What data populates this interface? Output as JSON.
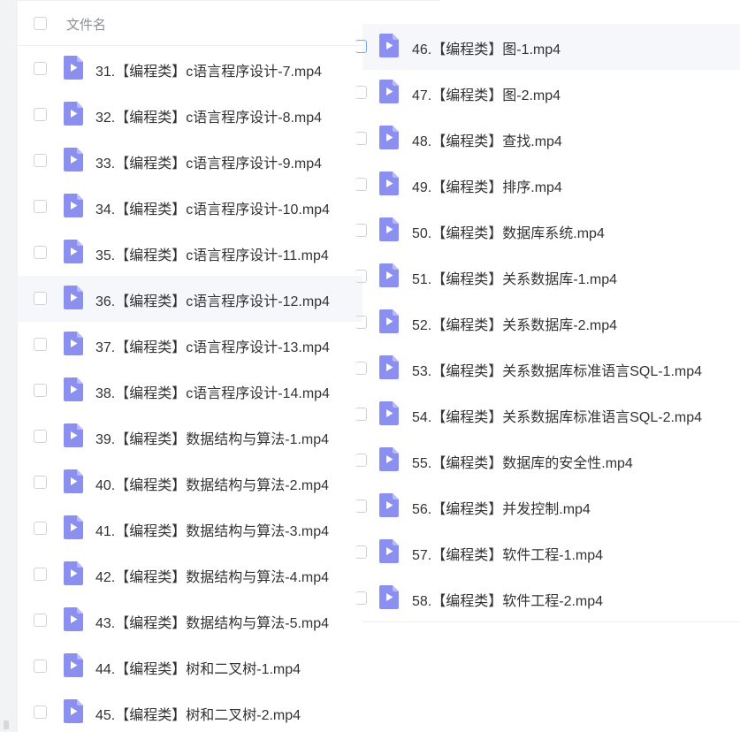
{
  "header": {
    "column_label": "文件名"
  },
  "icons": {
    "file": "video-file-icon",
    "color": "#8b8ff0"
  },
  "left_list": [
    {
      "name": "31.【编程类】c语言程序设计-7.mp4"
    },
    {
      "name": "32.【编程类】c语言程序设计-8.mp4"
    },
    {
      "name": "33.【编程类】c语言程序设计-9.mp4"
    },
    {
      "name": "34.【编程类】c语言程序设计-10.mp4"
    },
    {
      "name": "35.【编程类】c语言程序设计-11.mp4"
    },
    {
      "name": "36.【编程类】c语言程序设计-12.mp4"
    },
    {
      "name": "37.【编程类】c语言程序设计-13.mp4"
    },
    {
      "name": "38.【编程类】c语言程序设计-14.mp4"
    },
    {
      "name": "39.【编程类】数据结构与算法-1.mp4"
    },
    {
      "name": "40.【编程类】数据结构与算法-2.mp4"
    },
    {
      "name": "41.【编程类】数据结构与算法-3.mp4"
    },
    {
      "name": "42.【编程类】数据结构与算法-4.mp4"
    },
    {
      "name": "43.【编程类】数据结构与算法-5.mp4"
    },
    {
      "name": "44.【编程类】树和二叉树-1.mp4"
    },
    {
      "name": "45.【编程类】树和二叉树-2.mp4"
    }
  ],
  "right_list": [
    {
      "name": "46.【编程类】图-1.mp4"
    },
    {
      "name": "47.【编程类】图-2.mp4"
    },
    {
      "name": "48.【编程类】查找.mp4"
    },
    {
      "name": "49.【编程类】排序.mp4"
    },
    {
      "name": "50.【编程类】数据库系统.mp4"
    },
    {
      "name": "51.【编程类】关系数据库-1.mp4"
    },
    {
      "name": "52.【编程类】关系数据库-2.mp4"
    },
    {
      "name": "53.【编程类】关系数据库标准语言SQL-1.mp4"
    },
    {
      "name": "54.【编程类】关系数据库标准语言SQL-2.mp4"
    },
    {
      "name": "55.【编程类】数据库的安全性.mp4"
    },
    {
      "name": "56.【编程类】并发控制.mp4"
    },
    {
      "name": "57.【编程类】软件工程-1.mp4"
    },
    {
      "name": "58.【编程类】软件工程-2.mp4"
    }
  ]
}
